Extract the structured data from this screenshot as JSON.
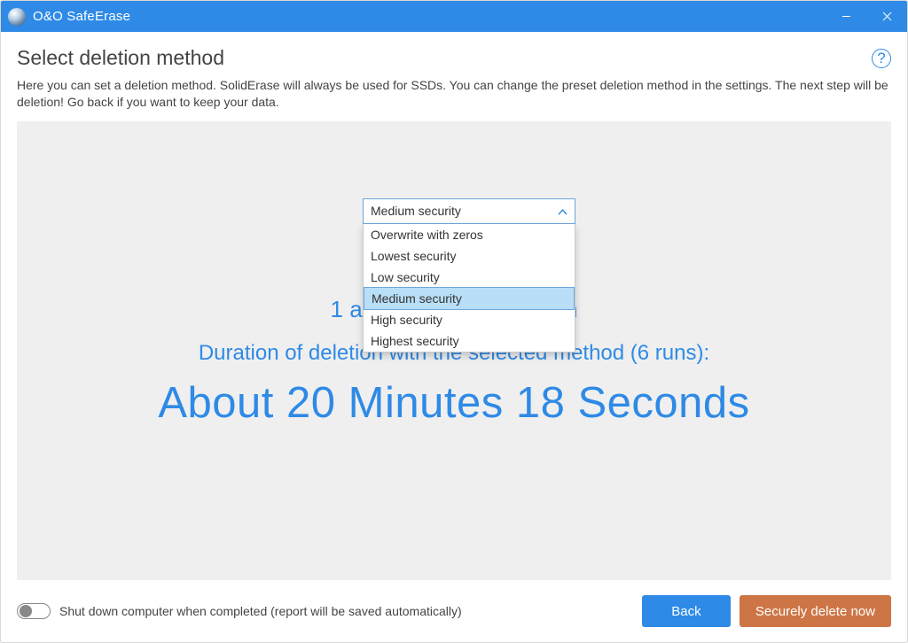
{
  "window": {
    "title": "O&O SafeErase"
  },
  "heading": "Select deletion method",
  "description": "Here you can set a deletion method. SolidErase will always be used for SSDs. You can change the preset deletion method in the settings. The next step will be deletion! Go back if you want to keep your data.",
  "dropdown": {
    "selected": "Medium security",
    "options": [
      "Overwrite with zeros",
      "Lowest security",
      "Low security",
      "Medium security",
      "High security",
      "Highest security"
    ]
  },
  "summary": {
    "line1": "1  action (10                                    ure deletion",
    "line2": "Duration of deletion with the selected method (6 runs):",
    "duration": "About  20 Minutes 18 Seconds"
  },
  "footer": {
    "shutdown_label": "Shut down computer when completed (report will be saved automatically)",
    "back_label": "Back",
    "delete_label": "Securely delete now"
  }
}
